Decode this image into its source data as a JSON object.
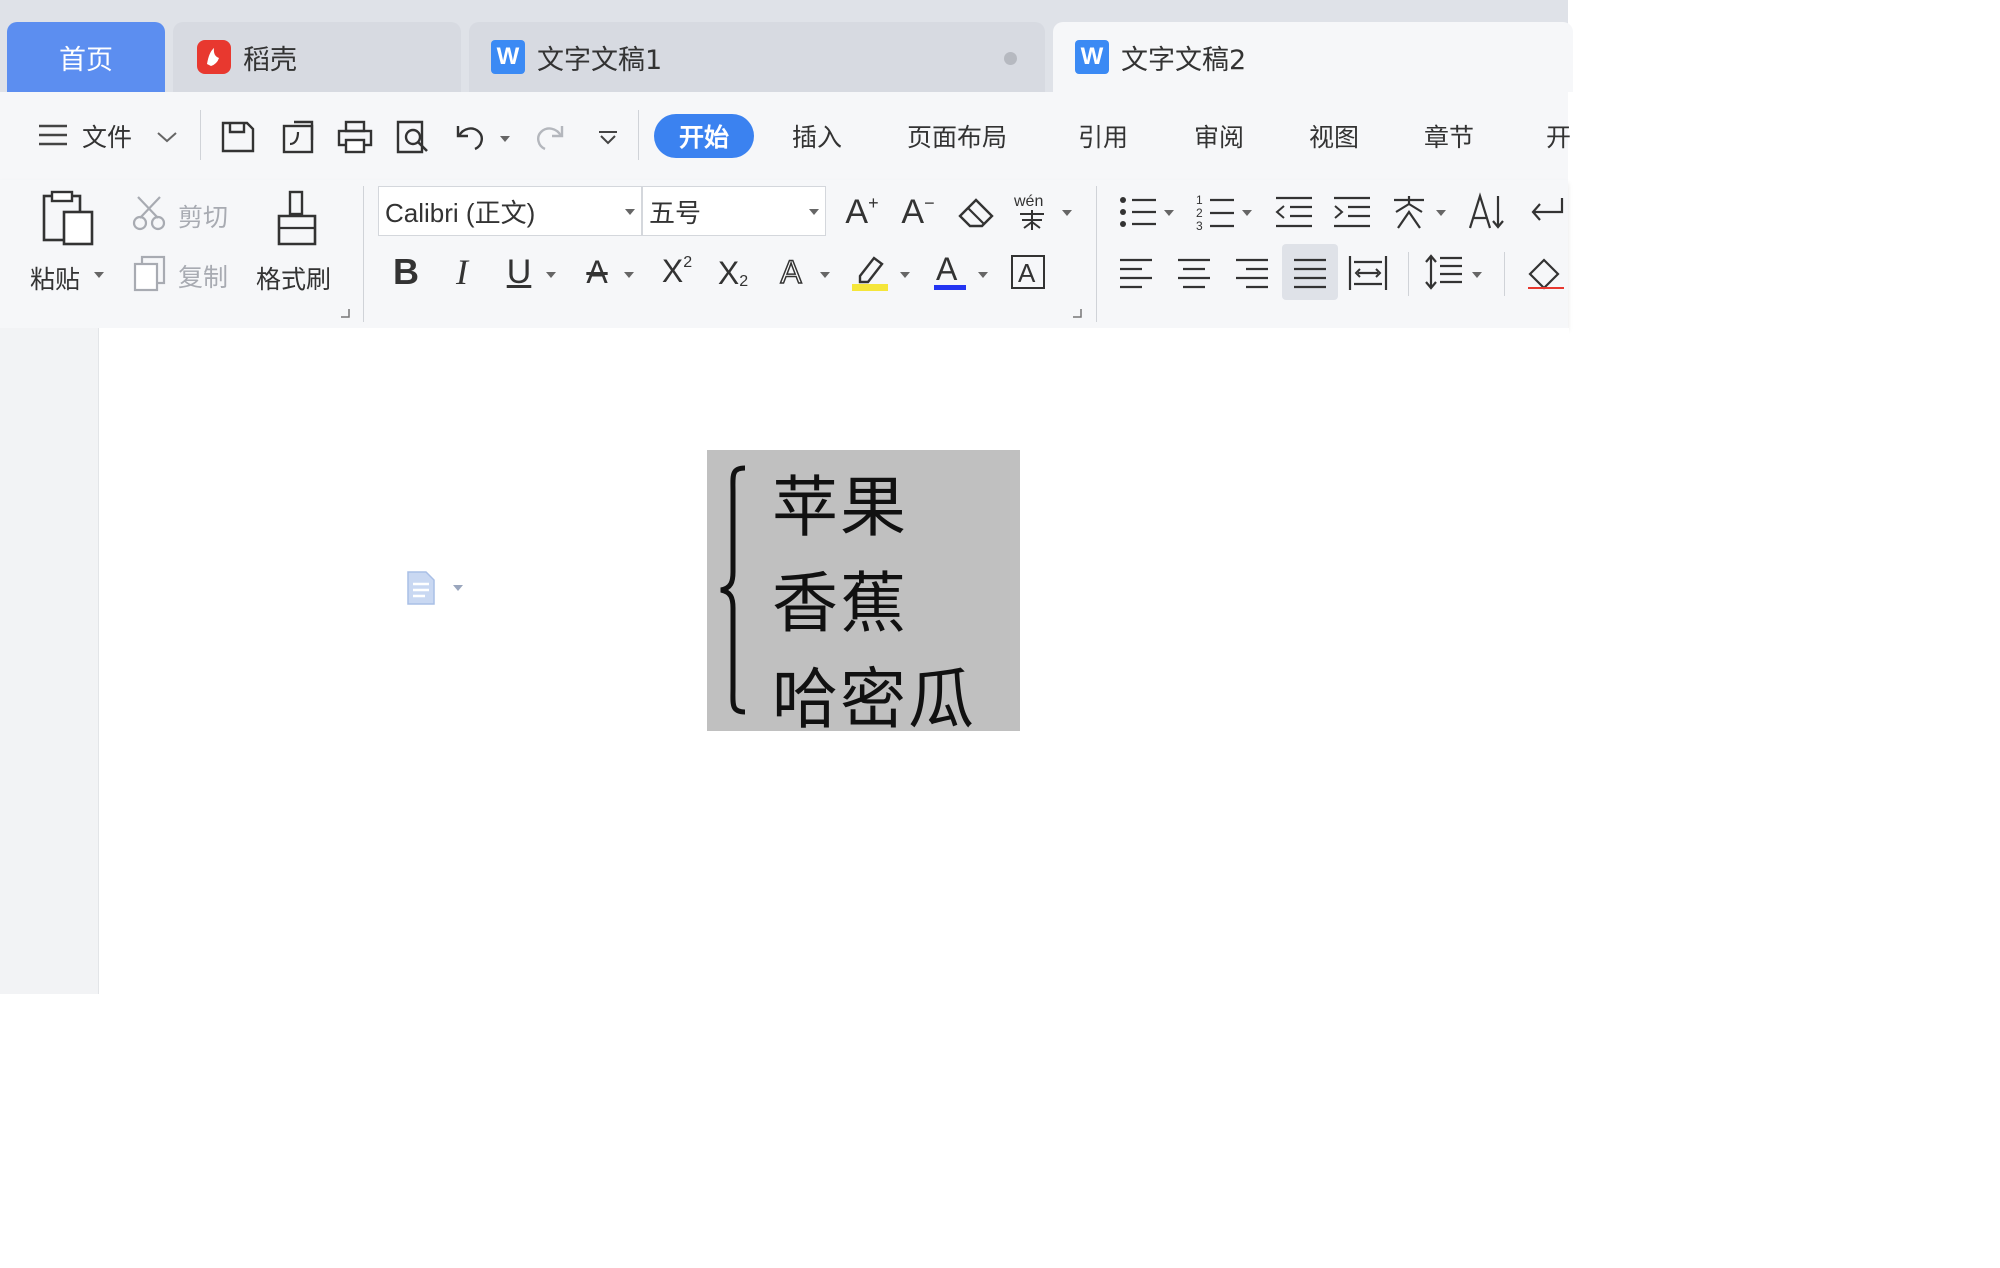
{
  "tabs": [
    {
      "label": "首页"
    },
    {
      "label": "稻壳"
    },
    {
      "label": "文字文稿1"
    },
    {
      "label": "文字文稿2"
    }
  ],
  "menu": {
    "file_label": "文件",
    "ribbon_tabs": [
      "开始",
      "插入",
      "页面布局",
      "引用",
      "审阅",
      "视图",
      "章节",
      "开"
    ]
  },
  "clipboard": {
    "paste_label": "粘贴",
    "cut_label": "剪切",
    "copy_label": "复制",
    "format_painter_label": "格式刷"
  },
  "font": {
    "family_value": "Calibri (正文)",
    "size_value": "五号"
  },
  "document": {
    "formula_lines": [
      "苹果",
      "香蕉",
      "哈密瓜"
    ]
  },
  "colors": {
    "accent": "#3b82f0",
    "home_tab": "#5c8ef0",
    "highlight_yellow": "#f5e63a",
    "font_color_blue": "#2435f2",
    "formula_background": "#c0c0c0"
  }
}
